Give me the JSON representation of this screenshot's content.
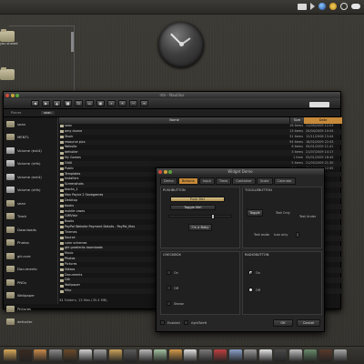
{
  "top_panel": {
    "tray_icons": [
      "mail-icon",
      "volume-icon",
      "globe-icon",
      "sun-icon",
      "power-icon",
      "cloud-icon"
    ]
  },
  "desktop": {
    "icons": [
      {
        "name": "folder-1",
        "label": "yeu shared"
      },
      {
        "name": "folder-2",
        "label": ""
      }
    ]
  },
  "file_manager": {
    "title": "rdn - Nautilus",
    "location_label": "Places",
    "breadcrumb": [
      "sean"
    ],
    "sidebar": [
      {
        "label": "sean",
        "kind": "folder"
      },
      {
        "label": "MENTL",
        "kind": "folder"
      },
      {
        "label": "Volume (ext4)",
        "kind": "drive"
      },
      {
        "label": "Volume (ntfs)",
        "kind": "drive"
      },
      {
        "label": "Volume (ext4)",
        "kind": "drive"
      },
      {
        "label": "Volume (ntfs)",
        "kind": "drive"
      },
      {
        "label": "sean",
        "kind": "folder"
      },
      {
        "label": "Trash",
        "kind": "folder"
      },
      {
        "label": "Downloads",
        "kind": "folder"
      },
      {
        "label": "Photos",
        "kind": "folder"
      },
      {
        "label": "git-core",
        "kind": "folder"
      },
      {
        "label": "Documents",
        "kind": "folder"
      },
      {
        "label": "PNGs",
        "kind": "folder"
      },
      {
        "label": "Wallpaper",
        "kind": "folder"
      },
      {
        "label": "Pictures",
        "kind": "folder"
      },
      {
        "label": "defcoiler",
        "kind": "folder"
      }
    ],
    "columns": {
      "name": "Name",
      "size": "Size",
      "date": "Date"
    },
    "rows": [
      {
        "name": "sean",
        "size": "16 items",
        "date": "11/05/2009 12:03"
      },
      {
        "name": "amy dunne",
        "size": "13 items",
        "date": "20/04/2009 10:54"
      },
      {
        "name": "Stock",
        "size": "31 items",
        "date": "12/11/2008 13:44"
      },
      {
        "name": "resource pics",
        "size": "94 items",
        "date": "18/02/2009 22:43"
      },
      {
        "name": "Website",
        "size": "6 items",
        "date": "09/01/2009 11:41"
      },
      {
        "name": "defcoiler",
        "size": "3 items",
        "date": "21/07/2009 14:17"
      },
      {
        "name": "My Games",
        "size": "1 item",
        "date": "05/01/2009 18:49"
      },
      {
        "name": "OldX",
        "size": "5 items",
        "date": "21/05/2009 21:30"
      },
      {
        "name": "Public",
        "size": "0 items",
        "date": "08/10/2009 12:45"
      },
      {
        "name": "Templates",
        "size": "",
        "date": "21.06"
      },
      {
        "name": "Installers",
        "size": "",
        "date": "21.16"
      },
      {
        "name": "Screenshots",
        "size": "",
        "date": "21.18"
      },
      {
        "name": "blocks_1",
        "size": "",
        "date": "21.18"
      },
      {
        "name": "Max Payne 2 Savegames",
        "size": "",
        "date": "21.19"
      },
      {
        "name": "Desktop",
        "size": "",
        "date": "21.20"
      },
      {
        "name": "books",
        "size": "",
        "date": "21.21"
      },
      {
        "name": "mobile cases",
        "size": "",
        "date": "21.21"
      },
      {
        "name": "GIMVistr",
        "size": "",
        "date": "21.21"
      },
      {
        "name": "Books",
        "size": "",
        "date": "21.21"
      },
      {
        "name": "PayPal Website Payment Details - PayPal_files",
        "size": "",
        "date": "21.21"
      },
      {
        "name": "Themes",
        "size": "",
        "date": "21.21"
      },
      {
        "name": "Source",
        "size": "",
        "date": "21.21"
      },
      {
        "name": "color schemes",
        "size": "",
        "date": "21.21"
      },
      {
        "name": "gtk gradients downloads",
        "size": "",
        "date": "21.21"
      },
      {
        "name": "Music",
        "size": "",
        "date": "21.21"
      },
      {
        "name": "Photos",
        "size": "",
        "date": "21.21"
      },
      {
        "name": "Pictures",
        "size": "",
        "date": "21.21"
      },
      {
        "name": "Videos",
        "size": "",
        "date": "21.21"
      },
      {
        "name": "Documents",
        "size": "",
        "date": "21.21"
      },
      {
        "name": "Gtk",
        "size": "",
        "date": "21.21"
      },
      {
        "name": "Wallpaper",
        "size": "",
        "date": "21.21"
      },
      {
        "name": "Misc",
        "size": "",
        "date": "21.21"
      }
    ],
    "status": "34 Folders, 13 files (35.4 MB)"
  },
  "dialog": {
    "title": "Widget Demo",
    "tabs": [
      "Demo",
      "Buttons",
      "Input",
      "Trees",
      "Container",
      "Scale",
      "Calendar"
    ],
    "active_tab": "Buttons",
    "sections": {
      "push_button": "PUSHBUTTON",
      "toggle_button": "TOGGLEBUTTON",
      "checkbox": "CHECKBOX",
      "radiobutton": "RADIOBUTTON"
    },
    "buttons": {
      "push_me": "Push Me!",
      "toggle_me": "Toggle Me!",
      "tiny_button": "I'm a Baby",
      "toggle": "Toggle",
      "ok": "OK",
      "cancel": "Cancel"
    },
    "labels": {
      "text_only": "Text Only",
      "text_under": "Text Under",
      "text_aside": "Text aside",
      "icon_only": "Icon only",
      "on": "On",
      "off": "Off",
      "shown": "Shown",
      "enabled": "Enabled",
      "right_left": "rightToleft"
    }
  }
}
